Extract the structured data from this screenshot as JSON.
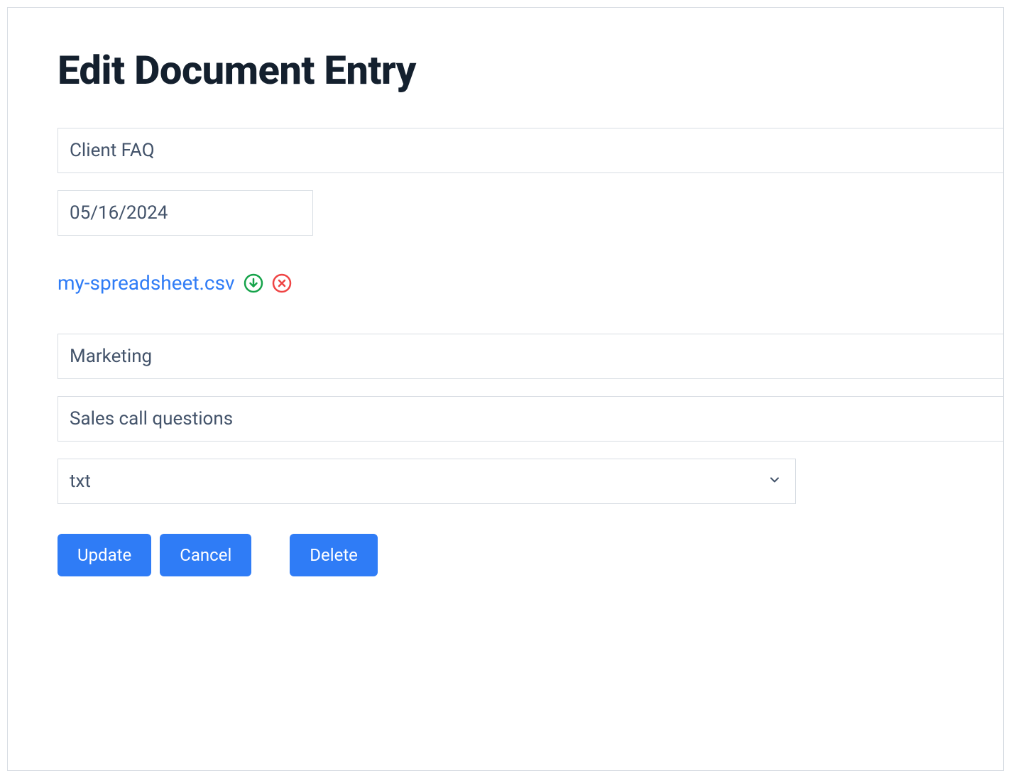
{
  "page": {
    "title": "Edit Document Entry"
  },
  "form": {
    "title_value": "Client FAQ",
    "date_value": "05/16/2024",
    "category_value": "Marketing",
    "description_value": "Sales call questions",
    "format_value": "txt"
  },
  "attachment": {
    "filename": "my-spreadsheet.csv"
  },
  "icons": {
    "download": "download-icon",
    "remove": "remove-icon",
    "caret": "chevron-down-icon"
  },
  "buttons": {
    "update": "Update",
    "cancel": "Cancel",
    "delete": "Delete"
  }
}
